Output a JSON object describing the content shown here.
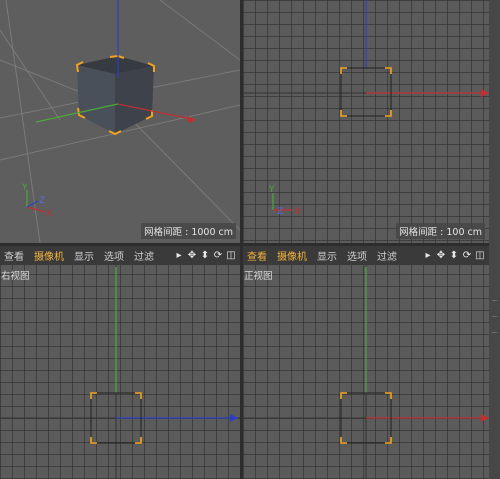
{
  "viewports": {
    "perspective": {
      "grid_spacing": "网格间距 : 1000 cm"
    },
    "top": {
      "grid_spacing": "网格间距 : 100 cm"
    },
    "right": {
      "name": "右视图"
    },
    "front": {
      "name": "正视图"
    }
  },
  "menus": {
    "left": [
      "查看",
      "摄像机",
      "显示",
      "选项",
      "过滤"
    ],
    "right": [
      "查看",
      "摄像机",
      "显示",
      "选项",
      "过滤"
    ]
  },
  "axis_labels": {
    "x": "X",
    "y": "Y",
    "z": "Z"
  },
  "colors": {
    "x_axis": "#c03030",
    "y_axis": "#4aa93a",
    "z_axis": "#2e3ec4",
    "selection": "#f2a21c",
    "menu_highlight": "#f2b33c"
  },
  "icons": [
    "menu-arrow-icon",
    "move-icon",
    "pan-icon",
    "rotate-icon",
    "maximize-icon"
  ]
}
